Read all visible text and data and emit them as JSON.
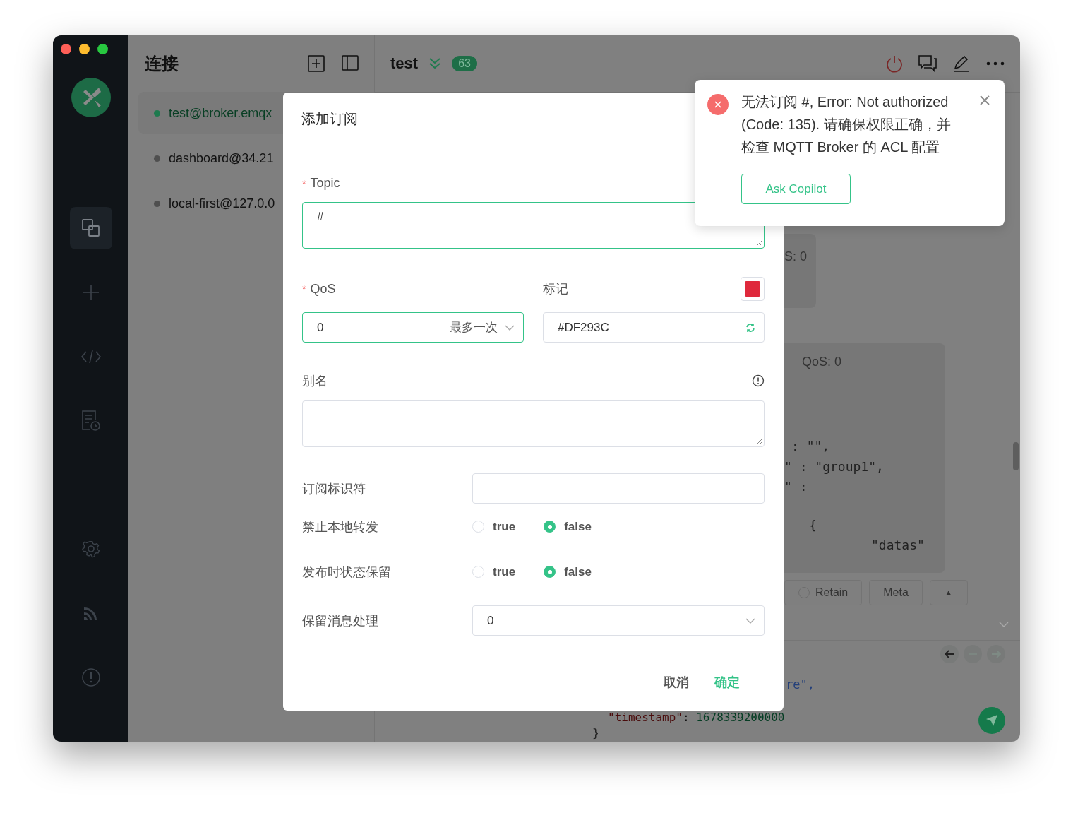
{
  "sidebar": {
    "items": [
      {
        "kind": "connections",
        "selected": true
      },
      {
        "kind": "new",
        "selected": false
      },
      {
        "kind": "script",
        "selected": false
      },
      {
        "kind": "log",
        "selected": false
      },
      {
        "kind": "settings",
        "selected": false
      },
      {
        "kind": "feed",
        "selected": false
      },
      {
        "kind": "about",
        "selected": false
      }
    ]
  },
  "connections": {
    "title": "连接",
    "items": [
      {
        "name": "test@broker.emqx",
        "selected": true,
        "connected": true
      },
      {
        "name": "dashboard@34.21",
        "selected": false,
        "connected": false
      },
      {
        "name": "local-first@127.0.0",
        "selected": false,
        "connected": false
      }
    ]
  },
  "main": {
    "title": "test",
    "badge": "63",
    "messages": [
      {
        "meta": "S: 0"
      },
      {
        "meta": "QoS: 0",
        "code": [
          ": \"\",",
          "\" : \"group1\",",
          "\" :",
          "{",
          "\"datas\""
        ]
      }
    ],
    "toolbar": [
      {
        "kind": "radio",
        "label": "Retain"
      },
      {
        "kind": "text",
        "label": "Meta"
      },
      {
        "kind": "caret",
        "label": "▲"
      }
    ],
    "editor_code": "re\",",
    "bottom_code": {
      "key": "\"timestamp\"",
      "sep": ": ",
      "value": "1678339200000",
      "close": "}"
    }
  },
  "dialog": {
    "title": "添加订阅",
    "topic": {
      "label": "Topic",
      "required_mark": "*",
      "value": "#"
    },
    "qos": {
      "label": "QoS",
      "required_mark": "*",
      "value": "0",
      "hint": "最多一次"
    },
    "mark": {
      "label": "标记",
      "value": "#DF293C",
      "color": "#df293c"
    },
    "alias": {
      "label": "别名"
    },
    "sub_id": {
      "label": "订阅标识符"
    },
    "radios": [
      {
        "label": "禁止本地转发",
        "options": [
          {
            "label": "true",
            "selected": false
          },
          {
            "label": "false",
            "selected": true
          }
        ]
      },
      {
        "label": "发布时状态保留",
        "options": [
          {
            "label": "true",
            "selected": false
          },
          {
            "label": "false",
            "selected": true
          }
        ]
      }
    ],
    "retain_handling": {
      "label": "保留消息处理",
      "value": "0"
    },
    "buttons": [
      {
        "label": "取消",
        "primary": false
      },
      {
        "label": "确定",
        "primary": true
      }
    ]
  },
  "notification": {
    "message": "无法订阅 #, Error: Not authorized (Code: 135). 请确保权限正确，并检查 MQTT Broker 的 ACL 配置",
    "button": "Ask Copilot"
  }
}
